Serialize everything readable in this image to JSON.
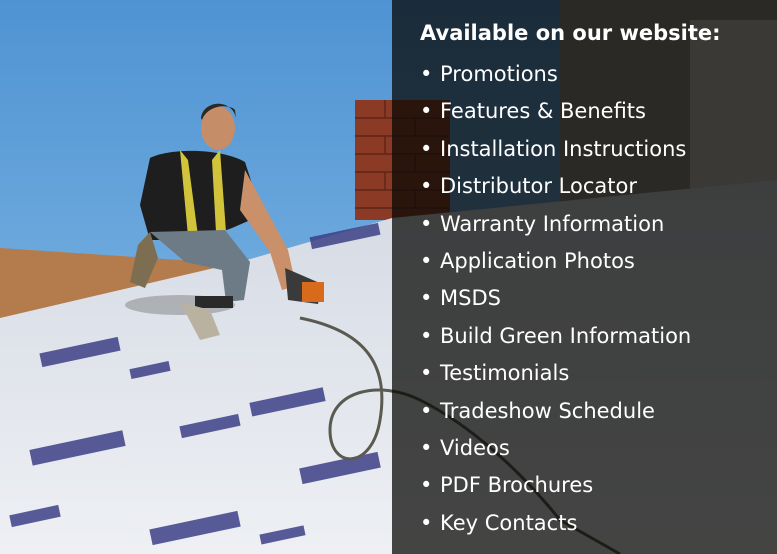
{
  "panel": {
    "heading": "Available on our website:",
    "bullet_glyph": "•",
    "items": [
      "Promotions",
      "Features & Benefits",
      "Installation Instructions",
      "Distributor Locator",
      "Warranty Information",
      "Application Photos",
      "MSDS",
      "Build Green Information",
      "Testimonials",
      "Tradeshow Schedule",
      "Videos",
      "PDF Brochures",
      "Key Contacts"
    ],
    "text_color": "#ffffff",
    "overlay_color": "#080806"
  },
  "photo": {
    "sky_color": "#5a9fd8",
    "underlayment_color": "#e6e9ef",
    "print_color": "#3c3f86",
    "wood_color": "#b47c4c"
  }
}
